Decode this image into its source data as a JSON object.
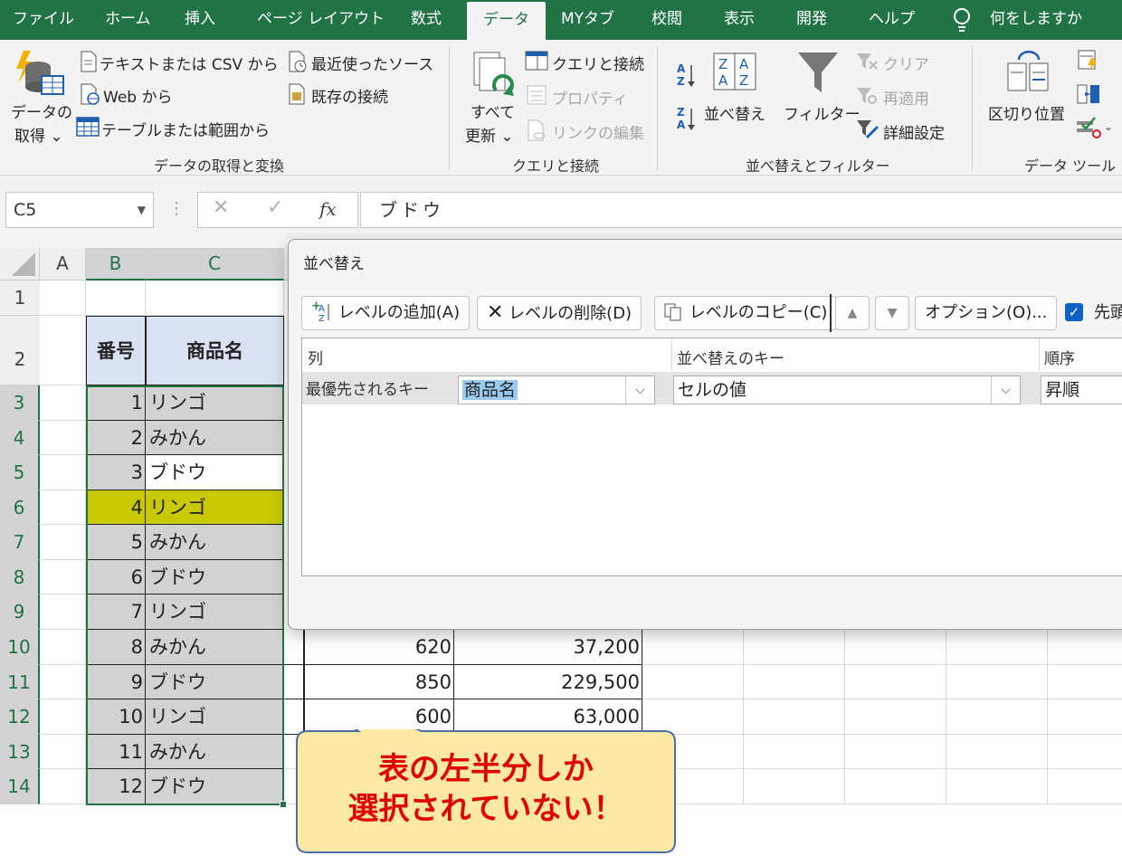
{
  "ribbon_tabs": [
    "ファイル",
    "ホーム",
    "挿入",
    "ページ レイアウト",
    "数式",
    "データ",
    "MYタブ",
    "校閲",
    "表示",
    "開発",
    "ヘルプ"
  ],
  "active_tab": "データ",
  "tell_me": "何をしますか",
  "ribbon": {
    "get_data_line1": "データの",
    "get_data_line2": "取得 ⌄",
    "from_text_csv": "テキストまたは CSV から",
    "from_web": "Web から",
    "from_table": "テーブルまたは範囲から",
    "recent_sources": "最近使ったソース",
    "existing_conn": "既存の接続",
    "group_get_transform": "データの取得と変換",
    "refresh_line1": "すべて",
    "refresh_line2": "更新 ⌄",
    "queries_conn": "クエリと接続",
    "properties": "プロパティ",
    "edit_links": "リンクの編集",
    "group_queries": "クエリと接続",
    "sort": "並べ替え",
    "filter": "フィルター",
    "clear": "クリア",
    "reapply": "再適用",
    "advanced": "詳細設定",
    "group_sort_filter": "並べ替えとフィルター",
    "text_to_columns": "区切り位置",
    "group_data_tools": "データ ツール"
  },
  "formula_bar": {
    "name_box": "C5",
    "formula": "ブドウ"
  },
  "sheet": {
    "columns": [
      "A",
      "B",
      "C"
    ],
    "row_numbers": [
      "1",
      "2",
      "3",
      "4",
      "5",
      "6",
      "7",
      "8",
      "9",
      "10",
      "11",
      "12",
      "13",
      "14"
    ],
    "header_no": "番号",
    "header_name": "商品名",
    "rows": [
      {
        "no": "1",
        "name": "リンゴ"
      },
      {
        "no": "2",
        "name": "みかん"
      },
      {
        "no": "3",
        "name": "ブドウ"
      },
      {
        "no": "4",
        "name": "リンゴ"
      },
      {
        "no": "5",
        "name": "みかん"
      },
      {
        "no": "6",
        "name": "ブドウ"
      },
      {
        "no": "7",
        "name": "リンゴ"
      },
      {
        "no": "8",
        "name": "みかん"
      },
      {
        "no": "9",
        "name": "ブドウ"
      },
      {
        "no": "10",
        "name": "リンゴ"
      },
      {
        "no": "11",
        "name": "みかん"
      },
      {
        "no": "12",
        "name": "ブドウ"
      }
    ],
    "visible_extra": [
      {
        "price": "620",
        "total": "37,200"
      },
      {
        "price": "850",
        "total": "229,500"
      },
      {
        "price": "600",
        "total": "63,000"
      }
    ],
    "highlight_color": "#c9c900",
    "header_fill": "#d9e1f2"
  },
  "sort_dialog": {
    "title": "並べ替え",
    "add_level": "レベルの追加(A)",
    "delete_level": "レベルの削除(D)",
    "copy_level": "レベルのコピー(C)",
    "options": "オプション(O)...",
    "header_checkbox": "先頭",
    "col_header": "列",
    "key_header": "並べ替えのキー",
    "order_header": "順序",
    "row_label": "最優先されるキー",
    "column_value": "商品名",
    "key_value": "セルの値",
    "order_value": "昇順"
  },
  "callout": {
    "line1": "表の左半分しか",
    "line2": "選択されていない！",
    "text_color": "#e00000",
    "fill_color": "#fde9a6"
  }
}
